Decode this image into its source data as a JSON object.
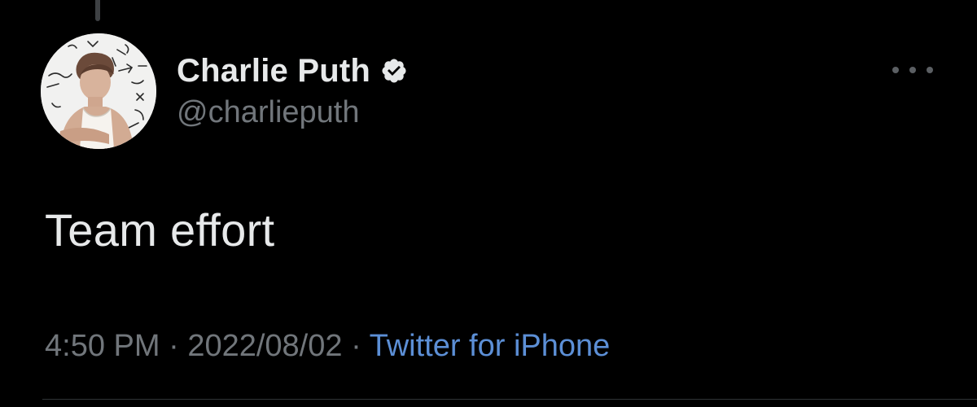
{
  "tweet": {
    "author": {
      "display_name": "Charlie Puth",
      "handle": "@charlieputh",
      "verified": true,
      "avatar_icon": "profile-photo"
    },
    "text": "Team effort",
    "time": "4:50 PM",
    "separator": "·",
    "date": "2022/08/02",
    "source": "Twitter for iPhone"
  },
  "colors": {
    "background": "#000000",
    "primary_text": "#e7e9ea",
    "secondary_text": "#71767b",
    "link": "#5c8fd6"
  },
  "icons": {
    "more": "more-dots-icon",
    "verified": "verified-badge-icon"
  }
}
